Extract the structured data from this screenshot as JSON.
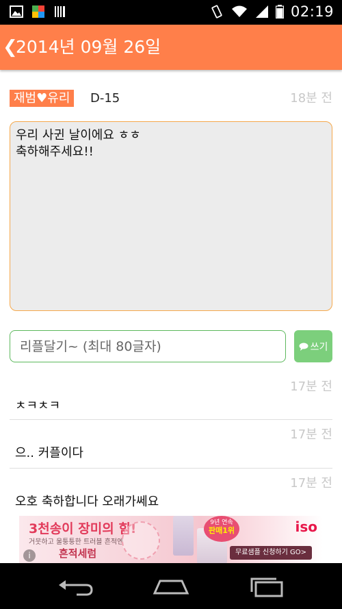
{
  "status_bar": {
    "time": "02:19",
    "icons": [
      "picture-icon",
      "app-icon",
      "barcode-icon",
      "vibrate-icon",
      "wifi-icon",
      "signal-icon",
      "battery-icon"
    ]
  },
  "app_bar": {
    "back_glyph": "❮",
    "title": "2014년 09월 26일",
    "color": "#ff7f4a"
  },
  "post": {
    "couple": "재범♥유리",
    "dday": "D-15",
    "time": "18분 전",
    "lines": [
      "우리 사귄 날이에요 ㅎㅎ",
      "",
      "축하해주세요!!"
    ]
  },
  "reply_form": {
    "placeholder": "리플달기~ (최대 80글자)",
    "write_label": "쓰기"
  },
  "replies": [
    {
      "time": "17분 전",
      "text": "ㅊㅋㅊㅋ"
    },
    {
      "time": "17분 전",
      "text": "으.. 커플이다"
    },
    {
      "time": "17분 전",
      "text": "오호 축하합니다 오래가쎄요"
    }
  ],
  "ad": {
    "headline": "3천송이 장미의 힘!",
    "subline": "거뭇하고 울퉁퉁한 트러블 흔적엔",
    "product": "흔적세럼",
    "badge_top": "9년 연속",
    "badge_main": "판매1위",
    "brand": "iso",
    "cta": "무료샘플 신청하기 GO>",
    "info": "i"
  }
}
